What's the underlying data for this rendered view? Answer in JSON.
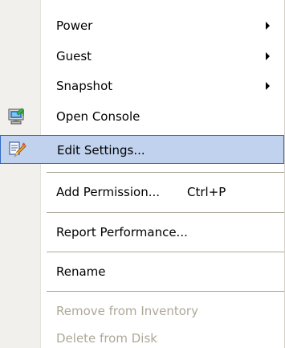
{
  "menu": {
    "items": [
      {
        "label": "Power",
        "submenu": true,
        "enabled": true
      },
      {
        "label": "Guest",
        "submenu": true,
        "enabled": true
      },
      {
        "label": "Snapshot",
        "submenu": true,
        "enabled": true
      },
      {
        "label": "Open Console",
        "icon": "console-icon",
        "enabled": true
      },
      {
        "label": "Edit Settings...",
        "icon": "edit-settings-icon",
        "enabled": true,
        "highlighted": true
      },
      {
        "label": "Add Permission...",
        "shortcut": "Ctrl+P",
        "enabled": true
      },
      {
        "label": "Report Performance...",
        "enabled": true
      },
      {
        "label": "Rename",
        "enabled": true
      },
      {
        "label": "Remove from Inventory",
        "enabled": false
      },
      {
        "label": "Delete from Disk",
        "enabled": false
      }
    ]
  },
  "colors": {
    "highlight_fill": "#c1d2ee",
    "highlight_border": "#316ac5",
    "disabled_text": "#aca899",
    "icon_strip": "#f1f0ed"
  }
}
